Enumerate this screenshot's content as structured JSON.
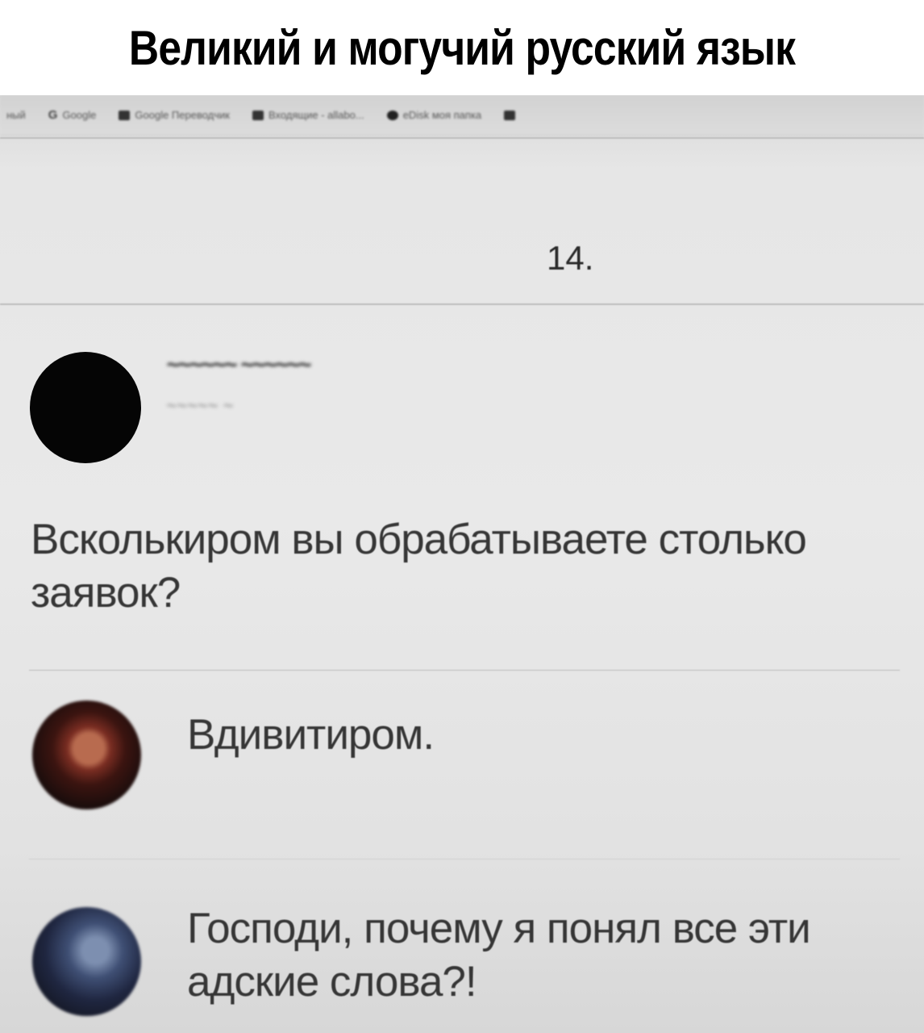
{
  "meme": {
    "title": "Великий и могучий русский язык"
  },
  "browser": {
    "bookmarks": [
      {
        "label": "ный",
        "icon": "partial-icon"
      },
      {
        "label": "Google",
        "icon": "google-icon"
      },
      {
        "label": "Google Переводчик",
        "icon": "translate-icon"
      },
      {
        "label": "Входящие - allabo...",
        "icon": "mail-icon"
      },
      {
        "label": "eDisk моя папка",
        "icon": "disk-icon"
      }
    ]
  },
  "page": {
    "number": "14."
  },
  "post": {
    "author": "",
    "meta": "",
    "text": "Всколькиром вы обрабатываете столько заявок?"
  },
  "replies": [
    {
      "text": "Вдивитиром."
    },
    {
      "text": "Господи, почему я понял все эти адские слова?!"
    }
  ]
}
